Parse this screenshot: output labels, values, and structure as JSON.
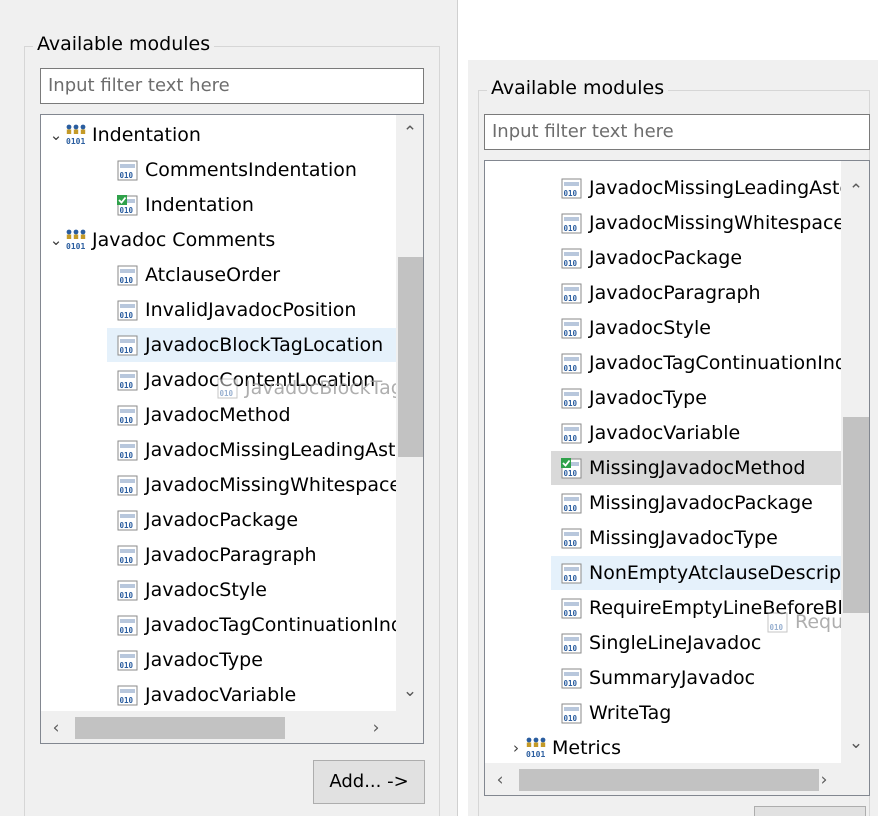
{
  "left": {
    "group_title": "Available modules",
    "filter_placeholder": "Input filter text here",
    "items": [
      {
        "label": "Indentation",
        "kind": "category"
      },
      {
        "label": "CommentsIndentation",
        "kind": "module"
      },
      {
        "label": "Indentation",
        "kind": "module-checked"
      },
      {
        "label": "Javadoc Comments",
        "kind": "category"
      },
      {
        "label": "AtclauseOrder",
        "kind": "module"
      },
      {
        "label": "InvalidJavadocPosition",
        "kind": "module"
      },
      {
        "label": "JavadocBlockTagLocation",
        "kind": "module"
      },
      {
        "label": "JavadocContentLocation",
        "kind": "module"
      },
      {
        "label": "JavadocMethod",
        "kind": "module"
      },
      {
        "label": "JavadocMissingLeadingAsterisk",
        "kind": "module"
      },
      {
        "label": "JavadocMissingWhitespaceAfterAsterisk",
        "kind": "module"
      },
      {
        "label": "JavadocPackage",
        "kind": "module"
      },
      {
        "label": "JavadocParagraph",
        "kind": "module"
      },
      {
        "label": "JavadocStyle",
        "kind": "module"
      },
      {
        "label": "JavadocTagContinuationIndentation",
        "kind": "module"
      },
      {
        "label": "JavadocType",
        "kind": "module"
      },
      {
        "label": "JavadocVariable",
        "kind": "module"
      }
    ],
    "drag_ghost": "JavadocBlockTagLocation",
    "add_button": "Add... ->"
  },
  "right": {
    "group_title": "Available modules",
    "filter_placeholder": "Input filter text here",
    "items": [
      {
        "label": "JavadocMissingLeadingAsterisk",
        "kind": "module"
      },
      {
        "label": "JavadocMissingWhitespaceAfterAsterisk",
        "kind": "module"
      },
      {
        "label": "JavadocPackage",
        "kind": "module"
      },
      {
        "label": "JavadocParagraph",
        "kind": "module"
      },
      {
        "label": "JavadocStyle",
        "kind": "module"
      },
      {
        "label": "JavadocTagContinuationIndentation",
        "kind": "module"
      },
      {
        "label": "JavadocType",
        "kind": "module"
      },
      {
        "label": "JavadocVariable",
        "kind": "module"
      },
      {
        "label": "MissingJavadocMethod",
        "kind": "module-checked"
      },
      {
        "label": "MissingJavadocPackage",
        "kind": "module"
      },
      {
        "label": "MissingJavadocType",
        "kind": "module"
      },
      {
        "label": "NonEmptyAtclauseDescription",
        "kind": "module"
      },
      {
        "label": "RequireEmptyLineBeforeBlockTagGroup",
        "kind": "module"
      },
      {
        "label": "SingleLineJavadoc",
        "kind": "module"
      },
      {
        "label": "SummaryJavadoc",
        "kind": "module"
      },
      {
        "label": "WriteTag",
        "kind": "module"
      },
      {
        "label": "Metrics",
        "kind": "category"
      }
    ],
    "drag_ghost": "RequireEmptyLineBeforeBlockTagGroup"
  },
  "colors": {
    "pane_bg": "#f0f0f0",
    "hover_row": "#e5f1fb",
    "selected_row": "#d9d9d9",
    "check_green": "#2fa14a",
    "icon_blue": "#2a5d9f"
  },
  "icons": {
    "category": "module-group-icon",
    "module": "module-icon",
    "checked": "checked-module-icon",
    "expand": "chevron-down-icon",
    "scroll_up": "scroll-up-arrow-icon",
    "scroll_down": "scroll-down-arrow-icon",
    "scroll_left": "scroll-left-arrow-icon",
    "scroll_right": "scroll-right-arrow-icon"
  }
}
